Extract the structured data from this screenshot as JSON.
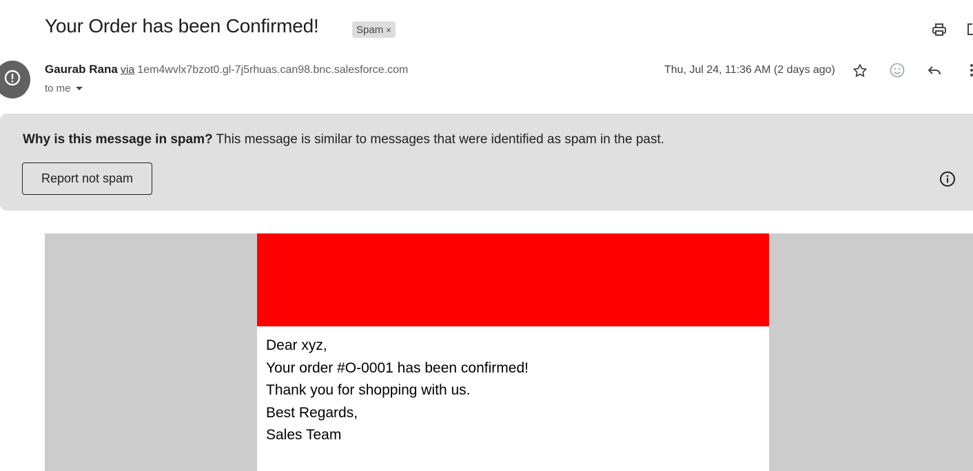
{
  "email": {
    "subject": "Your Order has been Confirmed!",
    "label_chip": "Spam",
    "label_chip_remove": "×",
    "sender_name": "Gaurab Rana",
    "via": "via",
    "sender_address": "1em4wvlx7bzot0.gl-7j5rhuas.can98.bnc.salesforce.com",
    "recipient": "to me",
    "date": "Thu, Jul 24, 11:36 AM (2 days ago)"
  },
  "spam_banner": {
    "question": "Why is this message in spam?",
    "explanation": "This message is similar to messages that were identified as spam in the past.",
    "report_button": "Report not spam"
  },
  "body": {
    "header_color": "#ff0000",
    "lines": [
      "Dear xyz,",
      "Your order #O-0001 has been confirmed!",
      "Thank you for shopping with us.",
      "Best Regards,",
      "Sales Team"
    ]
  },
  "icons": {
    "print": "print-icon",
    "open_new_window": "open-in-new-window-icon",
    "star": "star-icon",
    "emoji": "emoji-reaction-icon",
    "reply": "reply-icon",
    "more": "more-vert-icon",
    "avatar": "spam-warning-icon",
    "info": "info-icon",
    "dropdown": "caret-down-icon"
  }
}
